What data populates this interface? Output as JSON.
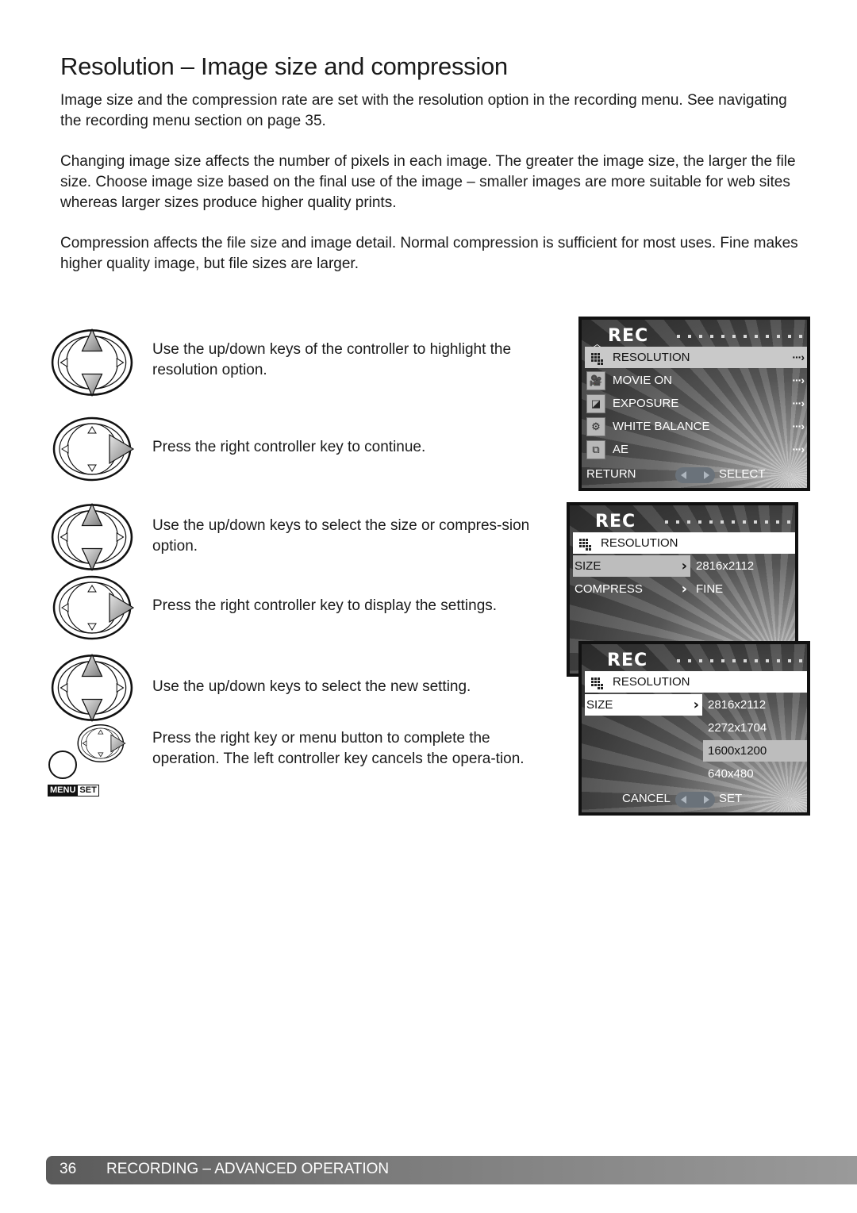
{
  "page": {
    "title": "Resolution – Image size and compression",
    "paragraphs": [
      "Image size and the compression rate are set with the resolution option in the recording menu. See navigating the recording menu section on page 35.",
      "Changing image size affects the number of pixels in each image. The greater the image size, the larger the file size. Choose image size based on the final use of the image – smaller images are more suitable for web sites whereas larger sizes produce higher quality prints.",
      "Compression affects the file size and image detail. Normal compression is sufficient for most uses. Fine makes higher quality image, but file sizes are larger."
    ]
  },
  "steps": [
    {
      "text": "Use the up/down keys of the controller to highlight the resolution option.",
      "icon": "controller-up-down-icon"
    },
    {
      "text": "Press the right controller key to continue.",
      "icon": "controller-right-icon"
    },
    {
      "text": "Use the up/down keys to select the size or compres-sion option.",
      "icon": "controller-up-down-icon"
    },
    {
      "text": "Press the right controller key to display the settings.",
      "icon": "controller-right-icon"
    },
    {
      "text": "Use the up/down keys to select the new setting.",
      "icon": "controller-up-down-icon"
    },
    {
      "text": "Press the right key or menu button to complete the operation. The left controller key cancels the opera-tion.",
      "icon": "controller-right-and-menu-icon"
    }
  ],
  "menu_button": {
    "menu": "MENU",
    "set": "SET"
  },
  "screen1": {
    "header": "REC",
    "items": [
      {
        "label": "RESOLUTION",
        "icon": "resolution-icon",
        "highlighted": true
      },
      {
        "label": "MOVIE ON",
        "icon": "movie-camera-icon",
        "highlighted": false
      },
      {
        "label": "EXPOSURE",
        "icon": "exposure-icon",
        "highlighted": false
      },
      {
        "label": "WHITE BALANCE",
        "icon": "white-balance-icon",
        "highlighted": false
      },
      {
        "label": "AE",
        "icon": "ae-icon",
        "highlighted": false
      }
    ],
    "footer_left": "RETURN",
    "footer_right": "SELECT"
  },
  "screen2": {
    "header": "REC",
    "section": "RESOLUTION",
    "rows": [
      {
        "label": "SIZE",
        "value": "2816x2112",
        "highlighted": true
      },
      {
        "label": "COMPRESS",
        "value": "FINE",
        "highlighted": false
      }
    ]
  },
  "screen3": {
    "header": "REC",
    "section": "RESOLUTION",
    "row_label": "SIZE",
    "options": [
      "2816x2112",
      "2272x1704",
      "1600x1200",
      "640x480"
    ],
    "selected_option": "1600x1200",
    "footer_left": "CANCEL",
    "footer_right": "SET"
  },
  "footer": {
    "page_number": "36",
    "section": "RECORDING – ADVANCED OPERATION"
  }
}
